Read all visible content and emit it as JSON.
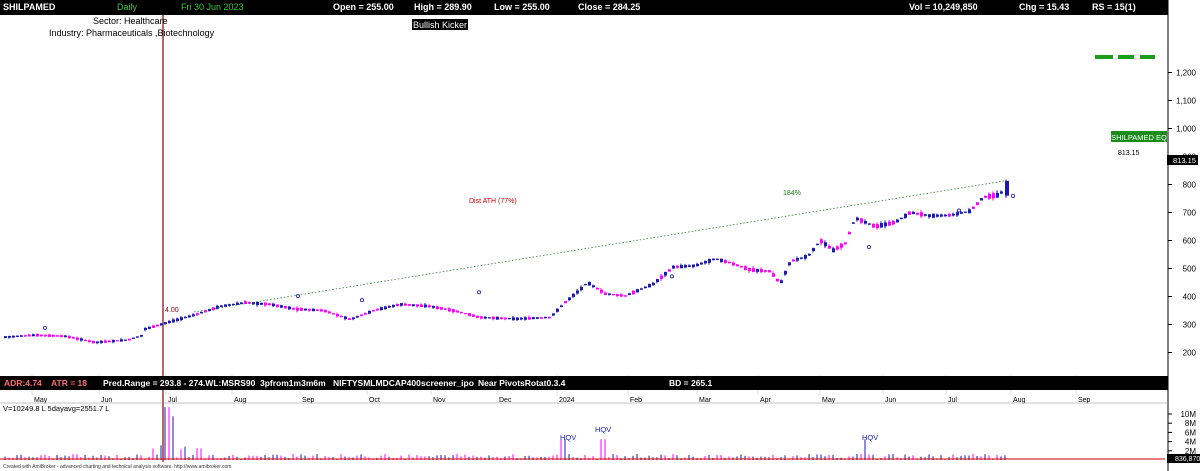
{
  "header": {
    "symbol": "SHILPAMED",
    "interval": "Daily",
    "date": "Fri 30 Jun 2023",
    "open": "Open = 255.00",
    "high": "High = 289.90",
    "low": "Low = 255.00",
    "close": "Close = 284.25",
    "vol": "Vol = 10,249,850",
    "chg": "Chg = 15.43",
    "rs": "RS = 15(1)"
  },
  "info": {
    "sector": "Sector: Healthcare",
    "industry": "Industry: Pharmaceuticals ,Biotechnology",
    "pattern": "Bullish Kicker",
    "dist_ath": "Dist ATH (77%)",
    "pct_label": "184%",
    "symbol_tag": "SHILPAMED EQ",
    "last_price_above": "813.15",
    "last_price_badge": "813.15",
    "bar_value": "4.00"
  },
  "stats_bar": {
    "adr": "ADR:4.74",
    "atr": "ATR = 18",
    "pred": "Pred.Range = 293.8 - 274.WL:MSRS90",
    "pfrom": "3pfrom1m3m6m",
    "index": "NIFTYSMLMDCAP400",
    "screener": "screener_ipo",
    "pivot": "Near PivotsRotat0.3.4",
    "bd": "BD = 265.1"
  },
  "volume_panel": {
    "label": "V=10249.8 L 5dayavg=2551.7 L",
    "axis_badge": "836,870",
    "hqv_labels": [
      "HQV",
      "HQV",
      "HQV"
    ]
  },
  "footer": "Created with AmiBroker - advanced charting and technical analysis software. http://www.amibroker.com",
  "colors": {
    "up": "#1a1ab0",
    "down": "#ff00ff",
    "trend": "#2e7d32",
    "vline": "#8b0000",
    "green_dash": "#1a9e1a"
  },
  "chart_data": {
    "type": "candlestick",
    "title": "SHILPAMED",
    "price_axis": {
      "ticks": [
        200,
        300,
        400,
        500,
        600,
        700,
        800,
        900,
        1000,
        1100,
        1200
      ],
      "tick_labels": [
        "200",
        "300",
        "400",
        "500",
        "600",
        "700",
        "800",
        "900",
        "1,000",
        "1,100",
        "1,200"
      ],
      "ylim": [
        130,
        1230
      ]
    },
    "volume_axis": {
      "ticks": [
        2,
        4,
        6,
        8,
        10
      ],
      "tick_labels": [
        "2M",
        "4M",
        "6M",
        "8M",
        "10M"
      ]
    },
    "months": [
      "May",
      "Jun",
      "Jul",
      "Aug",
      "Sep",
      "Oct",
      "Nov",
      "Dec",
      "2024",
      "Feb",
      "Mar",
      "Apr",
      "May",
      "Jun",
      "Jul",
      "Aug",
      "Sep"
    ],
    "price_path": [
      {
        "t": 0,
        "p": 255
      },
      {
        "t": 30,
        "p": 262
      },
      {
        "t": 60,
        "p": 258
      },
      {
        "t": 90,
        "p": 236
      },
      {
        "t": 123,
        "p": 245
      },
      {
        "t": 138,
        "p": 262
      },
      {
        "t": 140,
        "p": 284
      },
      {
        "t": 160,
        "p": 305
      },
      {
        "t": 190,
        "p": 335
      },
      {
        "t": 215,
        "p": 365
      },
      {
        "t": 240,
        "p": 378
      },
      {
        "t": 265,
        "p": 372
      },
      {
        "t": 290,
        "p": 355
      },
      {
        "t": 318,
        "p": 350
      },
      {
        "t": 345,
        "p": 318
      },
      {
        "t": 370,
        "p": 352
      },
      {
        "t": 395,
        "p": 372
      },
      {
        "t": 425,
        "p": 365
      },
      {
        "t": 450,
        "p": 348
      },
      {
        "t": 475,
        "p": 325
      },
      {
        "t": 510,
        "p": 320
      },
      {
        "t": 545,
        "p": 325
      },
      {
        "t": 560,
        "p": 380
      },
      {
        "t": 575,
        "p": 425
      },
      {
        "t": 582,
        "p": 450
      },
      {
        "t": 600,
        "p": 410
      },
      {
        "t": 620,
        "p": 402
      },
      {
        "t": 648,
        "p": 445
      },
      {
        "t": 668,
        "p": 505
      },
      {
        "t": 690,
        "p": 510
      },
      {
        "t": 710,
        "p": 535
      },
      {
        "t": 725,
        "p": 520
      },
      {
        "t": 745,
        "p": 495
      },
      {
        "t": 765,
        "p": 490
      },
      {
        "t": 775,
        "p": 445
      },
      {
        "t": 785,
        "p": 525
      },
      {
        "t": 803,
        "p": 545
      },
      {
        "t": 815,
        "p": 600
      },
      {
        "t": 828,
        "p": 565
      },
      {
        "t": 840,
        "p": 590
      },
      {
        "t": 850,
        "p": 680
      },
      {
        "t": 870,
        "p": 650
      },
      {
        "t": 890,
        "p": 665
      },
      {
        "t": 905,
        "p": 700
      },
      {
        "t": 925,
        "p": 688
      },
      {
        "t": 945,
        "p": 690
      },
      {
        "t": 965,
        "p": 705
      },
      {
        "t": 978,
        "p": 755
      },
      {
        "t": 995,
        "p": 763
      },
      {
        "t": 1001,
        "p": 813
      }
    ],
    "trendline": {
      "from": {
        "t": 190,
        "p": 345
      },
      "to": {
        "t": 1001,
        "p": 813
      }
    },
    "hqv_positions": [
      558,
      598,
      860
    ],
    "last_close": 813.15
  }
}
